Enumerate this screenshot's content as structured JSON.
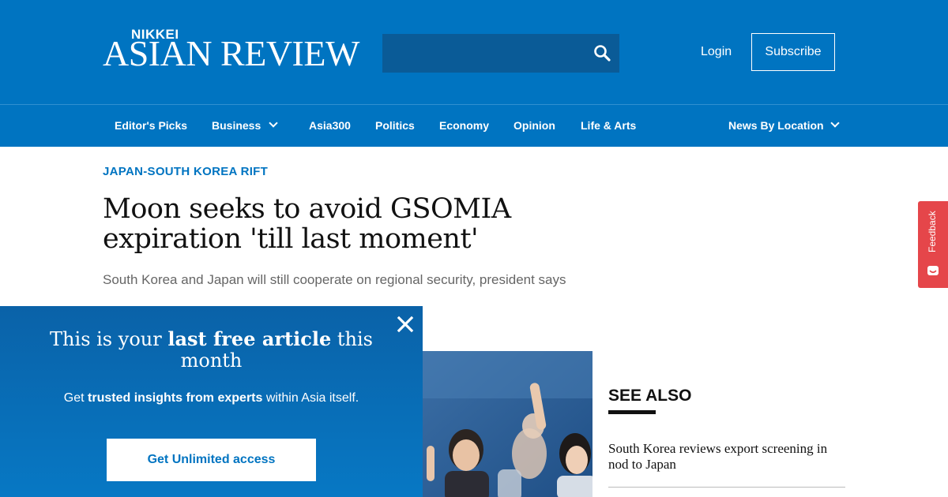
{
  "header": {
    "logo_top": "NIKKEI",
    "logo_main": "ASIAN REVIEW",
    "search_placeholder": "",
    "search_icon": "search-icon",
    "login_label": "Login",
    "subscribe_label": "Subscribe"
  },
  "nav": {
    "items": [
      {
        "label": "Editor's Picks"
      },
      {
        "label": "Business",
        "has_dropdown": true
      },
      {
        "label": "Asia300"
      },
      {
        "label": "Politics"
      },
      {
        "label": "Economy"
      },
      {
        "label": "Opinion"
      },
      {
        "label": "Life & Arts"
      }
    ],
    "location": {
      "label": "News By Location",
      "has_dropdown": true
    }
  },
  "article": {
    "kicker": "JAPAN-SOUTH KOREA RIFT",
    "headline": "Moon seeks to avoid GSOMIA expiration 'till last moment'",
    "subhead": "South Korea and Japan will still cooperate on regional security, president says"
  },
  "see_also": {
    "heading": "SEE ALSO",
    "items": [
      {
        "title": "South Korea reviews export screening in nod to Japan"
      }
    ]
  },
  "feedback": {
    "label": "Feedback"
  },
  "paywall": {
    "title_pre": "This is your ",
    "title_bold": "last free article",
    "title_post": " this month",
    "sub_pre": "Get ",
    "sub_bold": "trusted insights from experts",
    "sub_post": " within Asia itself.",
    "cta_label": "Get Unlimited access",
    "close_icon": "close-icon"
  },
  "colors": {
    "brand_blue": "#0074c1",
    "search_bg": "#0a5b97",
    "feedback_red": "#e5464a",
    "text_dark": "#111111",
    "text_muted": "#666666"
  }
}
